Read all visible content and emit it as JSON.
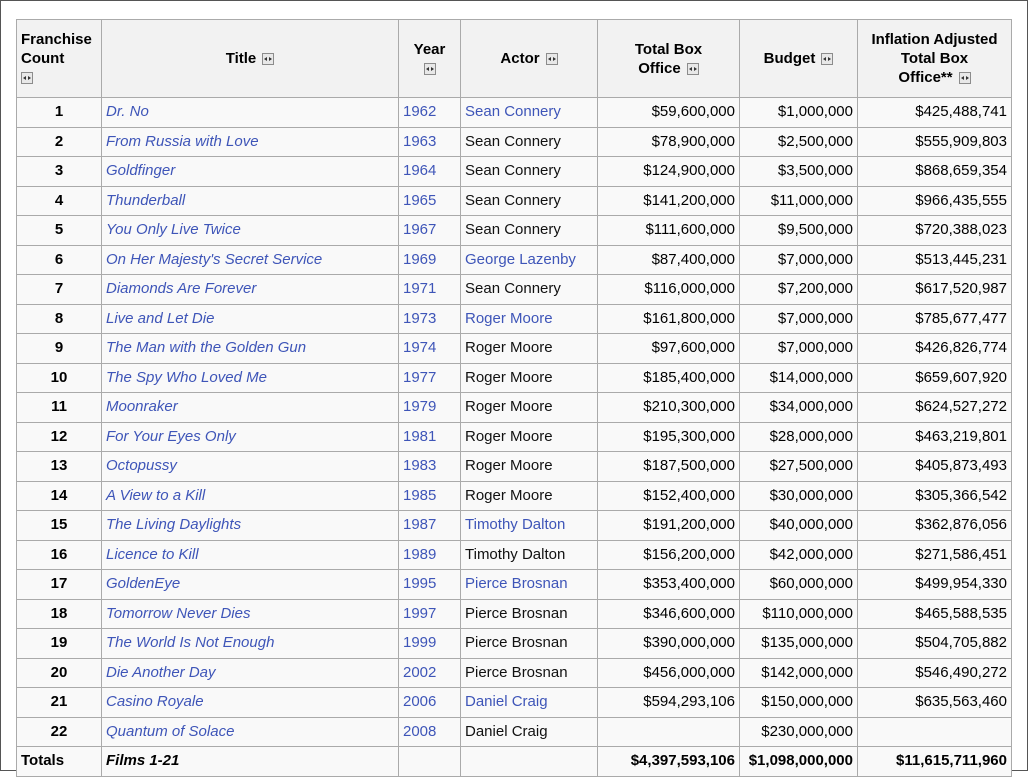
{
  "headers": {
    "count": [
      "Franchise",
      "Count"
    ],
    "title": "Title",
    "year": "Year",
    "actor": "Actor",
    "box_office": [
      "Total Box",
      "Office"
    ],
    "budget": "Budget",
    "inflation": [
      "Inflation Adjusted",
      "Total Box",
      "Office**"
    ]
  },
  "rows": [
    {
      "n": "1",
      "title": "Dr. No",
      "year": "1962",
      "actor": "Sean Connery",
      "actor_link": true,
      "box": "$59,600,000",
      "budget": "$1,000,000",
      "adj": "$425,488,741"
    },
    {
      "n": "2",
      "title": "From Russia with Love",
      "year": "1963",
      "actor": "Sean Connery",
      "actor_link": false,
      "box": "$78,900,000",
      "budget": "$2,500,000",
      "adj": "$555,909,803"
    },
    {
      "n": "3",
      "title": "Goldfinger",
      "year": "1964",
      "actor": "Sean Connery",
      "actor_link": false,
      "box": "$124,900,000",
      "budget": "$3,500,000",
      "adj": "$868,659,354"
    },
    {
      "n": "4",
      "title": "Thunderball",
      "year": "1965",
      "actor": "Sean Connery",
      "actor_link": false,
      "box": "$141,200,000",
      "budget": "$11,000,000",
      "adj": "$966,435,555"
    },
    {
      "n": "5",
      "title": "You Only Live Twice",
      "year": "1967",
      "actor": "Sean Connery",
      "actor_link": false,
      "box": "$111,600,000",
      "budget": "$9,500,000",
      "adj": "$720,388,023"
    },
    {
      "n": "6",
      "title": "On Her Majesty's Secret Service",
      "year": "1969",
      "actor": "George Lazenby",
      "actor_link": true,
      "box": "$87,400,000",
      "budget": "$7,000,000",
      "adj": "$513,445,231"
    },
    {
      "n": "7",
      "title": "Diamonds Are Forever",
      "year": "1971",
      "actor": "Sean Connery",
      "actor_link": false,
      "box": "$116,000,000",
      "budget": "$7,200,000",
      "adj": "$617,520,987"
    },
    {
      "n": "8",
      "title": "Live and Let Die",
      "year": "1973",
      "actor": "Roger Moore",
      "actor_link": true,
      "box": "$161,800,000",
      "budget": "$7,000,000",
      "adj": "$785,677,477"
    },
    {
      "n": "9",
      "title": "The Man with the Golden Gun",
      "year": "1974",
      "actor": "Roger Moore",
      "actor_link": false,
      "box": "$97,600,000",
      "budget": "$7,000,000",
      "adj": "$426,826,774"
    },
    {
      "n": "10",
      "title": "The Spy Who Loved Me",
      "year": "1977",
      "actor": "Roger Moore",
      "actor_link": false,
      "box": "$185,400,000",
      "budget": "$14,000,000",
      "adj": "$659,607,920"
    },
    {
      "n": "11",
      "title": "Moonraker",
      "year": "1979",
      "actor": "Roger Moore",
      "actor_link": false,
      "box": "$210,300,000",
      "budget": "$34,000,000",
      "adj": "$624,527,272"
    },
    {
      "n": "12",
      "title": "For Your Eyes Only",
      "year": "1981",
      "actor": "Roger Moore",
      "actor_link": false,
      "box": "$195,300,000",
      "budget": "$28,000,000",
      "adj": "$463,219,801"
    },
    {
      "n": "13",
      "title": "Octopussy",
      "year": "1983",
      "actor": "Roger Moore",
      "actor_link": false,
      "box": "$187,500,000",
      "budget": "$27,500,000",
      "adj": "$405,873,493"
    },
    {
      "n": "14",
      "title": "A View to a Kill",
      "year": "1985",
      "actor": "Roger Moore",
      "actor_link": false,
      "box": "$152,400,000",
      "budget": "$30,000,000",
      "adj": "$305,366,542"
    },
    {
      "n": "15",
      "title": "The Living Daylights",
      "year": "1987",
      "actor": "Timothy Dalton",
      "actor_link": true,
      "box": "$191,200,000",
      "budget": "$40,000,000",
      "adj": "$362,876,056"
    },
    {
      "n": "16",
      "title": "Licence to Kill",
      "year": "1989",
      "actor": "Timothy Dalton",
      "actor_link": false,
      "box": "$156,200,000",
      "budget": "$42,000,000",
      "adj": "$271,586,451"
    },
    {
      "n": "17",
      "title": "GoldenEye",
      "year": "1995",
      "actor": "Pierce Brosnan",
      "actor_link": true,
      "box": "$353,400,000",
      "budget": "$60,000,000",
      "adj": "$499,954,330"
    },
    {
      "n": "18",
      "title": "Tomorrow Never Dies",
      "year": "1997",
      "actor": "Pierce Brosnan",
      "actor_link": false,
      "box": "$346,600,000",
      "budget": "$110,000,000",
      "adj": "$465,588,535"
    },
    {
      "n": "19",
      "title": "The World Is Not Enough",
      "year": "1999",
      "actor": "Pierce Brosnan",
      "actor_link": false,
      "box": "$390,000,000",
      "budget": "$135,000,000",
      "adj": "$504,705,882"
    },
    {
      "n": "20",
      "title": "Die Another Day",
      "year": "2002",
      "actor": "Pierce Brosnan",
      "actor_link": false,
      "box": "$456,000,000",
      "budget": "$142,000,000",
      "adj": "$546,490,272"
    },
    {
      "n": "21",
      "title": "Casino Royale",
      "year": "2006",
      "actor": "Daniel Craig",
      "actor_link": true,
      "box": "$594,293,106",
      "budget": "$150,000,000",
      "adj": "$635,563,460"
    },
    {
      "n": "22",
      "title": "Quantum of Solace",
      "year": "2008",
      "actor": "Daniel Craig",
      "actor_link": false,
      "box": "",
      "budget": "$230,000,000",
      "adj": ""
    }
  ],
  "totals": {
    "label": "Totals",
    "title": "Films 1-21",
    "box": "$4,397,593,106",
    "budget": "$1,098,000,000",
    "adj": "$11,615,711,960"
  },
  "colors": {
    "link": "#3e55b8",
    "border": "#aaaaaa",
    "header_bg": "#f2f2f2",
    "cell_bg": "#f9f9f9"
  },
  "icons": {
    "sort": "sort-toggle-icon"
  }
}
